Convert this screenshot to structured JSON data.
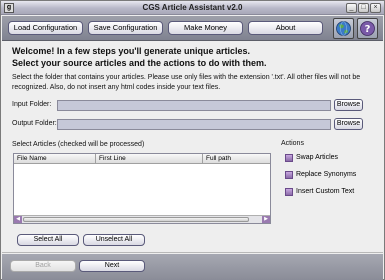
{
  "window": {
    "title": "CGS Article Assistant v2.0"
  },
  "toolbar": {
    "load_label": "Load Configuration",
    "save_label": "Save Configuration",
    "money_label": "Make Money",
    "about_label": "About"
  },
  "intro": {
    "welcome": "Welcome! In a few steps you'll generate unique articles.",
    "subtitle": "Select your source articles and the actions to do with them.",
    "description": "Select the folder that contains your articles. Please use only files with the extension '.txt'. All other files will not be recognized. Also, do not insert any html codes inside your text files."
  },
  "folders": {
    "input_label": "Input Folder:",
    "input_value": "",
    "output_label": "Output Folder:",
    "output_value": "",
    "browse_label": "Browse"
  },
  "articles": {
    "label": "Select Articles (checked will be processed)",
    "columns": [
      "File Name",
      "First Line",
      "Full path"
    ],
    "rows": [],
    "select_all_label": "Select All",
    "unselect_all_label": "Unselect All"
  },
  "actions": {
    "label": "Actions",
    "items": [
      {
        "label": "Swap Articles",
        "checked": false
      },
      {
        "label": "Replace Synonyms",
        "checked": false
      },
      {
        "label": "Insert Custom Text",
        "checked": false
      }
    ]
  },
  "nav": {
    "back_label": "Back",
    "next_label": "Next"
  },
  "colors": {
    "accent": "#8a6aa8",
    "toolbar": "#8f919d",
    "field": "#c6c8d8"
  },
  "icons": [
    "globe-icon",
    "help-icon",
    "app-icon",
    "minimize-icon",
    "maximize-icon",
    "close-icon"
  ]
}
